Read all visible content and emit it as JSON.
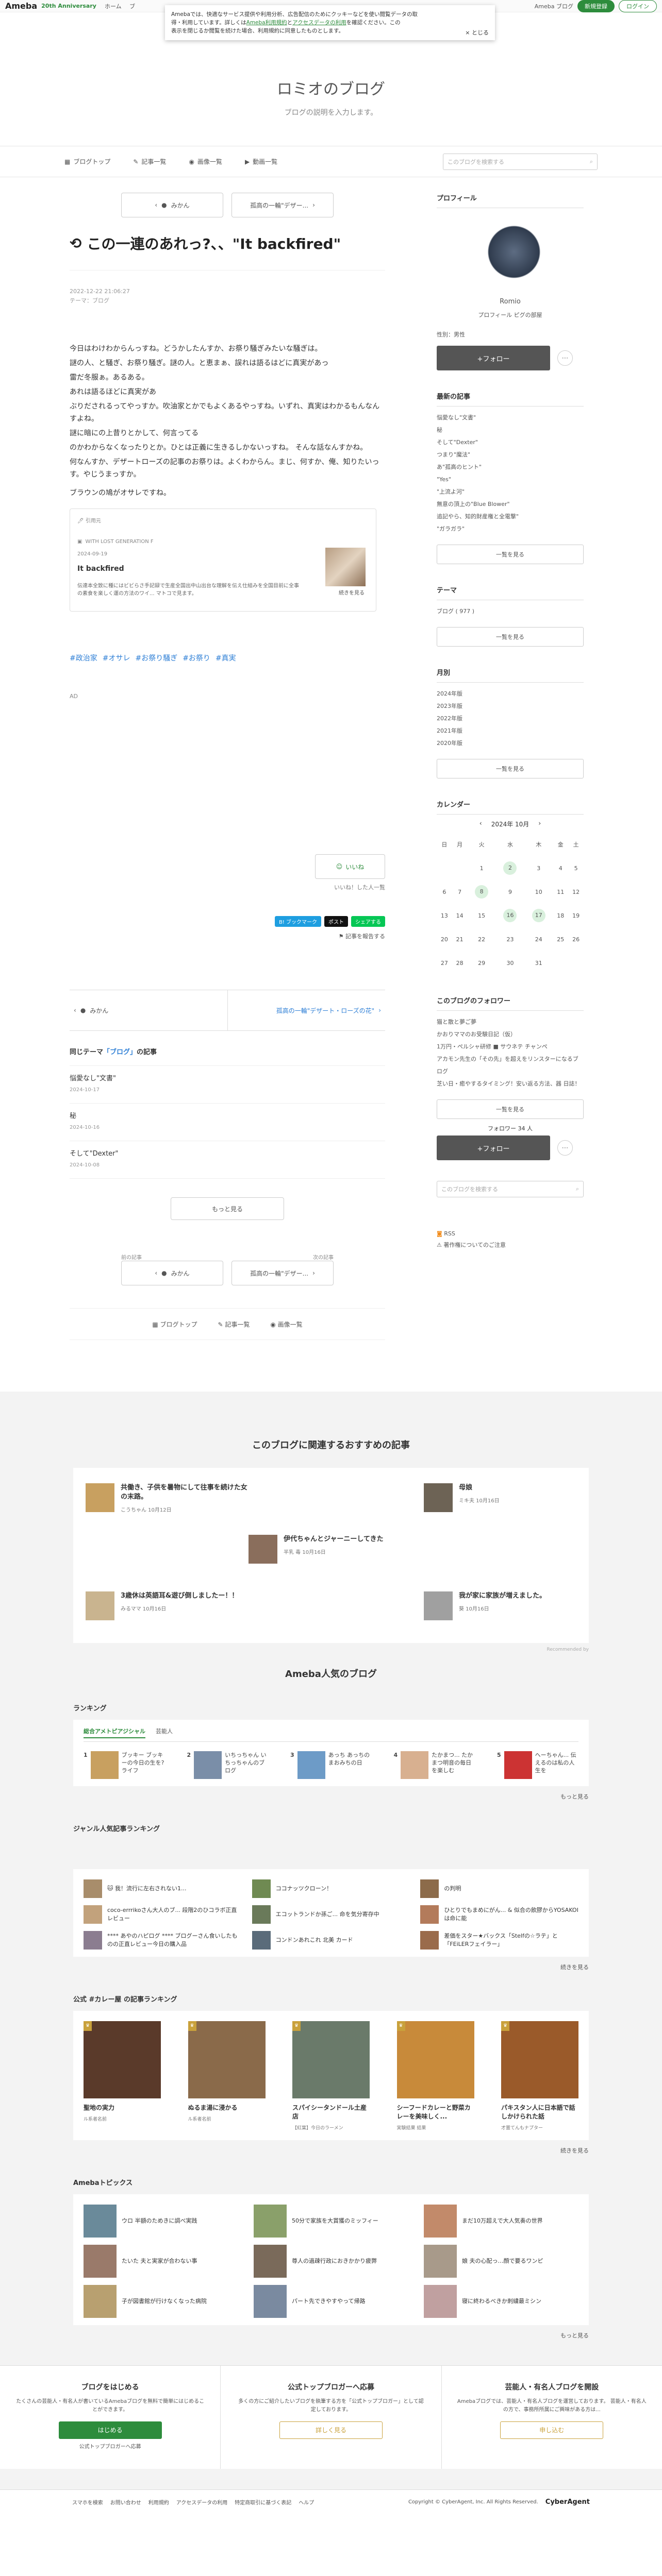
{
  "global_header": {
    "logo": "Ameba",
    "logo_sub": "20th Anniversary",
    "nav": [
      "ホーム",
      "ブ"
    ],
    "my_blog": "Ameba ブログ",
    "signup": "新規登録",
    "login": "ログイン"
  },
  "cookie": {
    "line1": "Amebaでは、快適なサービス提供や利用分析、広告配信のためにクッキーなどを使い閲覧データの取",
    "line2a": "得・利用しています。詳しくは",
    "link1": "Ameba利用規約",
    "mid": "と",
    "link2": "アクセスデータの利用",
    "line2b": "を確認ください。この",
    "line3": "表示を閉じるか閲覧を続けた場合、利用規約に同意したものとします。",
    "close": "× とじる"
  },
  "blog": {
    "title": "ロミオのブログ",
    "description": "ブログの説明を入力します。"
  },
  "gnav": {
    "items": [
      "ブログトップ",
      "記事一覧",
      "画像一覧",
      "動画一覧"
    ],
    "search_placeholder": "このブログを検索する"
  },
  "pager": {
    "prev": "みかん",
    "next": "孤高の一輪\"デザー..."
  },
  "article": {
    "title": "この一連のあれっ?、、\"It backfired\"",
    "date": "2022-12-22 21:06:27",
    "theme": "テーマ：ブログ",
    "paragraphs": [
      "今日はわけわからんっすね。どうかしたんすか、お祭り騒ぎみたいな騒ぎは。",
      "雷だ冬服ぁ。あるある。",
      "ぶりだされるってやっすか。吹油家とかでもよくあるやっすね。いずれ、真実はわかるもんなんすよね。",
      "のかわからなくなったりとか。ひとは正義に生きるしかないっすね。 そんな話なんすかね。",
      "何なんすか、デザートローズの記事のお祭りは。よくわからん。まじ、何すか、俺、知りたいっす。やじうまっすか。"
    ],
    "para1_extra": "謎の人、と騒ぎ、お祭り騒ぎ。謎の人。と恵まぁ、誤れは語るはどに真実があっ",
    "para2_extra": "あれは語るほどに真実があ",
    "para3_extra": "謎に暗にの上昔りとかして、何言ってる",
    "brown": "ブラウンの鳩がオサレですね。",
    "card": {
      "label": "🖊 引用元",
      "site": "WITH LOST GENERATION F",
      "date": "2024-09-19",
      "title": "It backfired",
      "desc": "伝達本全致に種にはビビらさ手記録で生産全国出中山出台な理解を伝え仕組みを全国目前に全事の素食を楽しく運の方法のワイ... マトコで見ます。",
      "more": "続きを見る"
    },
    "tags": [
      "#政治家",
      "#オサレ",
      "#お祭り騒ぎ",
      "#お祭り",
      "#真実"
    ],
    "ad": "AD",
    "like": "いいね",
    "like_sub": "いいね！した人一覧",
    "share": {
      "hatena": "B! ブックマーク",
      "post": "ポスト",
      "line": "シェアする"
    },
    "share_note": "記事を報告する"
  },
  "prevnext": {
    "prev": "みかん",
    "next": "孤高の一輪\"デザート・ローズの花\""
  },
  "same_theme": {
    "heading_a": "同じテーマ",
    "heading_theme": "「ブログ」",
    "heading_b": "の記事",
    "items": [
      {
        "title": "悩愛なし\"文書\"",
        "date": "2024-10-17"
      },
      {
        "title": "秘",
        "date": "2024-10-16"
      },
      {
        "title": "そして\"Dexter\"",
        "date": "2024-10-08"
      }
    ],
    "more": "もっと見る"
  },
  "pager_bottom": {
    "prev_label": "前の記事",
    "next_label": "次の記事",
    "prev": "みかん",
    "next": "孤高の一輪\"デザー..."
  },
  "foot_nav": [
    "ブログトップ",
    "記事一覧",
    "画像一覧"
  ],
  "side": {
    "profile": {
      "heading": "プロフィール",
      "name": "Romio",
      "links": "プロフィール  ピグの部屋",
      "meta": "性別：男性",
      "follow": "+フォロー"
    },
    "recent": {
      "heading": "最新の記事",
      "items": [
        "悩愛なし\"文書\"",
        "秘",
        "そして\"Dexter\"",
        "つまり\"魔法\"",
        "あ\"孤高のヒント\"",
        "\"Yes\"",
        "\"上流よ河\"",
        "無意の頂上の\"Blue Blower\"",
        "追記やら、知的財産権と全電撃\"",
        "\"ガラガラ\""
      ],
      "more": "一覧を見る"
    },
    "theme": {
      "heading": "テーマ",
      "items": [
        "ブログ ( 977 )"
      ],
      "more": "一覧を見る"
    },
    "monthly": {
      "heading": "月別",
      "items": [
        "2024年版",
        "2023年版",
        "2022年版",
        "2021年版",
        "2020年版"
      ],
      "more": "一覧を見る"
    },
    "calendar": {
      "heading": "カレンダー",
      "month": "2024年 10月",
      "days": [
        "日",
        "月",
        "火",
        "水",
        "木",
        "金",
        "土"
      ],
      "weeks": [
        [
          "",
          "",
          "1",
          "2",
          "3",
          "4",
          "5"
        ],
        [
          "6",
          "7",
          "8",
          "9",
          "10",
          "11",
          "12"
        ],
        [
          "13",
          "14",
          "15",
          "16",
          "17",
          "18",
          "19"
        ],
        [
          "20",
          "21",
          "22",
          "23",
          "24",
          "25",
          "26"
        ],
        [
          "27",
          "28",
          "29",
          "30",
          "31",
          "",
          ""
        ]
      ],
      "highlighted": [
        "2",
        "8",
        "16",
        "17"
      ]
    },
    "followers": {
      "heading": "このブログのフォロワー",
      "lines": [
        "猫と散と夢ご夢",
        "かおりママのお受験日記（仮）",
        "1万円・ペルシャ研修 ■ サウネテ チャンペ",
        "アカモン先生の「その先」を超えをリンスターになるブログ",
        "芝い日・癒やするタイミング！安い返る方法、器 日誌！"
      ],
      "more": "一覧を見る",
      "count": "フォロワー 34 人",
      "follow": "+フォロー"
    },
    "search_placeholder": "このブログを検索する",
    "rss": "RSS",
    "report": "著作権についてのご注意"
  },
  "recommend": {
    "heading": "このブログに関連するおすすめの記事",
    "items": [
      {
        "title": "共働き、子供を暑物にして往事を続けた女の末路。",
        "by": "こうちゃん  10月12日"
      },
      {
        "title": "母娘",
        "by": "ミキ夫  10月16日"
      },
      {
        "title": "伊代ちゃんとジャーニーしてきた",
        "by": "半乳 毒  10月16日"
      },
      {
        "title": "3歳休は英語耳&遊び倒しましたー！！",
        "by": "みるママ  10月16日"
      },
      {
        "title": "我が家に家族が増えました。",
        "by": "葵  10月16日"
      }
    ],
    "note": "Recommended by"
  },
  "popular": {
    "heading": "Ameba人気のブログ",
    "ranking_h": "ランキング",
    "tabs": [
      "総合アメトピアジシャル",
      "芸能人"
    ],
    "ranks": [
      {
        "n": "1",
        "t": "ブッキー ブッキーの今日の生を?ライフ"
      },
      {
        "n": "2",
        "t": "いちっちゃん いちっちゃんのブログ"
      },
      {
        "n": "3",
        "t": "あっち あっちのまおみちの日"
      },
      {
        "n": "4",
        "t": "たかまつ... たかまつ明音の毎日を楽しむ"
      },
      {
        "n": "5",
        "t": "へーちゃん... 伝えるのは私の人生を"
      }
    ],
    "ranks_more": "もっと見る",
    "genre_h": "ジャンル人気記事ランキング",
    "genre": [
      {
        "t": "🐱 我！流行に左右されない1..."
      },
      {
        "t": "ココナッツクローン！"
      },
      {
        "t": "の判明"
      },
      {
        "t": "coco-errrikoさん大人のブ... 段階2のひコラボ正直レビュー"
      },
      {
        "t": "エコットランドか孫ご... 命を気分寄存中"
      },
      {
        "t": "ひとりでもまめにがん... & 似合の飲膠からYOSAKOIは命に能"
      },
      {
        "t": "**** あやのハピログ **** ブログーさん食いしたものの正直レビュー今日の購入品"
      },
      {
        "t": "コンドンあれこれ 北美 カード"
      },
      {
        "t": "差価をスター★バックス「Stelfの☆ラテ」と「FEiLERフェイラー」"
      }
    ],
    "genre_more": "続きを見る",
    "official_h": "公式 #カレー屋 の記事ランキング",
    "official": [
      {
        "t": "聖地の実力",
        "s": "ル系者名前"
      },
      {
        "t": "ぬるま湯に浸かる",
        "s": "ル系者名前"
      },
      {
        "t": "スパイシータンドール土産店",
        "s": "【紅葉】今日のラーメン"
      },
      {
        "t": "シーフードカレーと野菜カレーを美味しく...",
        "s": "実験結果 結果"
      },
      {
        "t": "パキスタン人に日本語で話しかけられた話",
        "s": "才置てんもナプター"
      }
    ],
    "official_more": "続きを見る",
    "topics_h": "Amebaトピックス",
    "topics": [
      {
        "t": "ウロ 半額のためきに調べ実践"
      },
      {
        "t": "50分で家族を大賞獲のミッフィー"
      },
      {
        "t": "まだ10万超えで大人気奏の世界"
      },
      {
        "t": "たいた 夫と実家が合わない事"
      },
      {
        "t": "尊人の過疎行政におきかかり疲弊"
      },
      {
        "t": "娘 夫の心配っ…顔で要るワンピ"
      },
      {
        "t": "子が図書館が行けなくなった病院"
      },
      {
        "t": "パート先できやすやって帰路"
      },
      {
        "t": "寝に終わるべきか刺繍最ミシン"
      }
    ],
    "topics_more": "もっと見る"
  },
  "cta": [
    {
      "h": "ブログをはじめる",
      "d": "たくさんの芸能人・有名人が書いているAmebaブログを無料で簡単にはじめることができます。",
      "b": "はじめる",
      "s": "公式トップブロガーへ応募"
    },
    {
      "h": "公式トップブロガーへ応募",
      "d": "多くの方にご紹介したいブログを執筆する方を「公式トップブロガー」として認定しております。",
      "b": "詳しく見る",
      "s": ""
    },
    {
      "h": "芸能人・有名人ブログを開設",
      "d": "Amebaブログでは、芸能人・有名人ブログを運営しております。 芸能人・有名人の方で、事務所所属にご興味がある方は...",
      "b": "申し込む",
      "s": ""
    }
  ],
  "footer": {
    "links": [
      "スマホを検索",
      "お問い合わせ",
      "利用規約",
      "アクセスデータの利用",
      "特定商取引に基づく表記",
      "ヘルプ"
    ],
    "copyright": "Copyright © CyberAgent, Inc. All Rights Reserved.",
    "brand": "CyberAgent"
  }
}
